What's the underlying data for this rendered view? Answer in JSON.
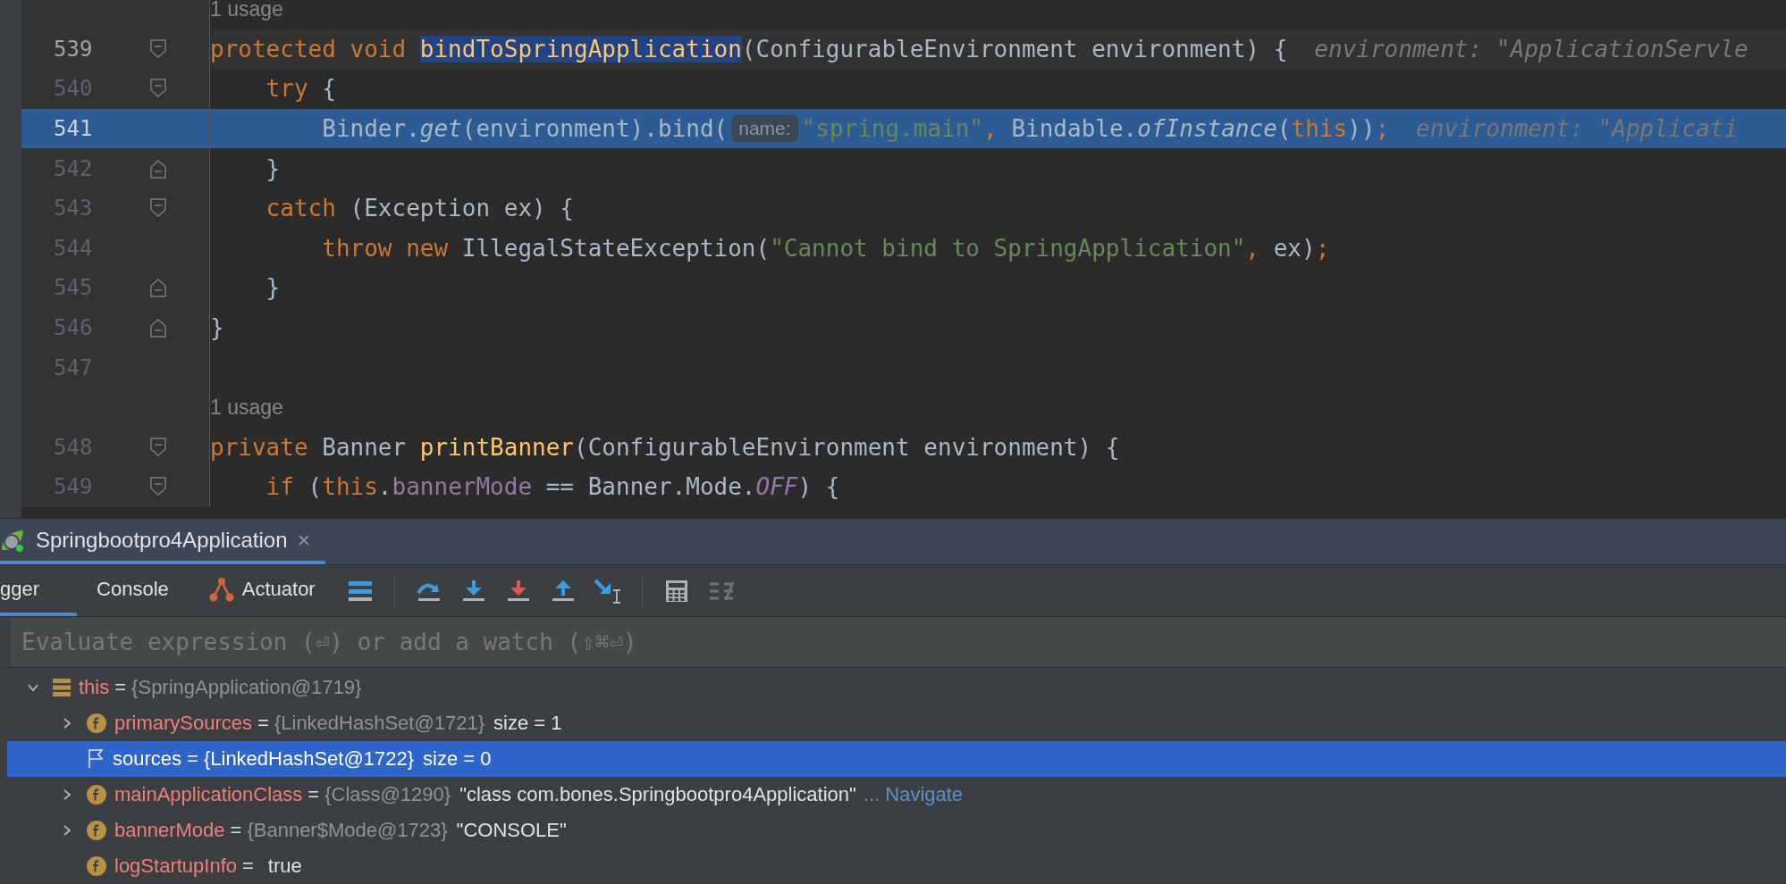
{
  "editor": {
    "lines": [
      {
        "kind": "usage",
        "text": "1 usage"
      },
      {
        "kind": "code",
        "number": "539",
        "current": true,
        "execution": false,
        "fold_start": true,
        "fold_end": false,
        "tokens": [
          {
            "kind": "keyword",
            "text": "protected void "
          },
          {
            "kind": "declaration",
            "text": "bindToSpringApplication",
            "highlighted": true
          },
          {
            "kind": "plain",
            "text": "(ConfigurableEnvironment environment) {"
          }
        ],
        "value_hint": "environment: \"ApplicationServle"
      },
      {
        "kind": "code",
        "number": "540",
        "current": false,
        "execution": false,
        "fold_start": true,
        "fold_end": false,
        "tokens": [
          {
            "kind": "keyword",
            "text": "    try"
          },
          {
            "kind": "plain",
            "text": " {"
          }
        ]
      },
      {
        "kind": "code",
        "number": "541",
        "current": false,
        "execution": true,
        "tokens": [
          {
            "kind": "plain",
            "text": "        Binder."
          },
          {
            "kind": "static",
            "text": "get"
          },
          {
            "kind": "plain",
            "text": "(environment).bind("
          },
          {
            "kind": "param",
            "text": "name:"
          },
          {
            "kind": "string",
            "text": "\"spring.main\""
          },
          {
            "kind": "keyword",
            "text": ", "
          },
          {
            "kind": "plain",
            "text": "Bindable."
          },
          {
            "kind": "static",
            "text": "ofInstance"
          },
          {
            "kind": "plain",
            "text": "("
          },
          {
            "kind": "keyword",
            "text": "this"
          },
          {
            "kind": "plain",
            "text": "))"
          },
          {
            "kind": "keyword",
            "text": ";"
          }
        ],
        "value_hint": "environment: \"Applicati"
      },
      {
        "kind": "code",
        "number": "542",
        "current": false,
        "execution": false,
        "fold_start": false,
        "fold_end": true,
        "tokens": [
          {
            "kind": "plain",
            "text": "    }"
          }
        ]
      },
      {
        "kind": "code",
        "number": "543",
        "current": false,
        "execution": false,
        "fold_start": true,
        "fold_end": false,
        "tokens": [
          {
            "kind": "keyword",
            "text": "    catch"
          },
          {
            "kind": "plain",
            "text": " (Exception ex) {"
          }
        ]
      },
      {
        "kind": "code",
        "number": "544",
        "current": false,
        "execution": false,
        "tokens": [
          {
            "kind": "keyword",
            "text": "        throw new "
          },
          {
            "kind": "plain",
            "text": "IllegalStateException("
          },
          {
            "kind": "string",
            "text": "\"Cannot bind to SpringApplication\""
          },
          {
            "kind": "keyword",
            "text": ", "
          },
          {
            "kind": "plain",
            "text": "ex)"
          },
          {
            "kind": "keyword",
            "text": ";"
          }
        ]
      },
      {
        "kind": "code",
        "number": "545",
        "current": false,
        "execution": false,
        "fold_start": false,
        "fold_end": true,
        "tokens": [
          {
            "kind": "plain",
            "text": "    }"
          }
        ]
      },
      {
        "kind": "code",
        "number": "546",
        "current": false,
        "execution": false,
        "fold_start": false,
        "fold_end": true,
        "tokens": [
          {
            "kind": "plain",
            "text": "}"
          }
        ]
      },
      {
        "kind": "code",
        "number": "547",
        "current": false,
        "execution": false
      },
      {
        "kind": "usage",
        "text": "1 usage"
      },
      {
        "kind": "code",
        "number": "548",
        "current": false,
        "execution": false,
        "fold_start": true,
        "fold_end": false,
        "tokens": [
          {
            "kind": "keyword",
            "text": "private "
          },
          {
            "kind": "plain",
            "text": "Banner "
          },
          {
            "kind": "declaration",
            "text": "printBanner",
            "highlighted": false
          },
          {
            "kind": "plain",
            "text": "(ConfigurableEnvironment environment) {"
          }
        ]
      },
      {
        "kind": "code",
        "number": "549",
        "current": false,
        "execution": false,
        "fold_start": true,
        "fold_end": false,
        "tokens": [
          {
            "kind": "keyword",
            "text": "    if "
          },
          {
            "kind": "plain",
            "text": "("
          },
          {
            "kind": "keyword",
            "text": "this"
          },
          {
            "kind": "plain",
            "text": "."
          },
          {
            "kind": "field",
            "text": "bannerMode"
          },
          {
            "kind": "plain",
            "text": " == Banner.Mode."
          },
          {
            "kind": "constant",
            "text": "OFF"
          },
          {
            "kind": "plain",
            "text": ") {"
          }
        ]
      }
    ]
  },
  "debug": {
    "session_tab": {
      "title": "Springbootpro4Application",
      "selected": true
    },
    "tabs": [
      {
        "kind": "text",
        "label": "gger",
        "selected": true
      },
      {
        "kind": "text",
        "label": "Console",
        "selected": false
      },
      {
        "kind": "actuator",
        "label": "Actuator",
        "selected": false
      }
    ],
    "tools": [
      {
        "kind": "layout",
        "disabled": false
      },
      {
        "kind": "separator"
      },
      {
        "kind": "step-over",
        "disabled": false
      },
      {
        "kind": "step-into",
        "disabled": false
      },
      {
        "kind": "force-step-into",
        "disabled": false
      },
      {
        "kind": "step-out",
        "disabled": false
      },
      {
        "kind": "run-to-cursor",
        "disabled": false
      },
      {
        "kind": "separator"
      },
      {
        "kind": "evaluate",
        "disabled": false
      },
      {
        "kind": "trace",
        "disabled": true
      }
    ],
    "watch": {
      "placeholder": "Evaluate expression (⏎) or add a watch (⇧⌘⏎)"
    },
    "variables": [
      {
        "kind": "object",
        "name": "this",
        "operator": "=",
        "type": "{SpringApplication@1719}",
        "expanded": true,
        "selected": false,
        "children": [
          {
            "kind": "field",
            "name": "primarySources",
            "operator": "=",
            "type": "{LinkedHashSet@1721}",
            "extra": "size = 1",
            "expanded": false,
            "selected": false
          },
          {
            "kind": "flag",
            "name": "sources",
            "operator": "=",
            "type": "{LinkedHashSet@1722}",
            "extra": "size = 0",
            "selected": true
          },
          {
            "kind": "field",
            "name": "mainApplicationClass",
            "operator": "=",
            "type": "{Class@1290}",
            "value": "\"class com.bones.Springbootpro4Application\"",
            "link": "... Navigate",
            "expanded": false,
            "selected": false
          },
          {
            "kind": "field",
            "name": "bannerMode",
            "operator": "=",
            "type": "{Banner$Mode@1723}",
            "value": "\"CONSOLE\"",
            "expanded": false,
            "selected": false
          },
          {
            "kind": "field",
            "name": "logStartupInfo",
            "operator": "=",
            "value": "true",
            "selected": false
          }
        ]
      }
    ]
  }
}
